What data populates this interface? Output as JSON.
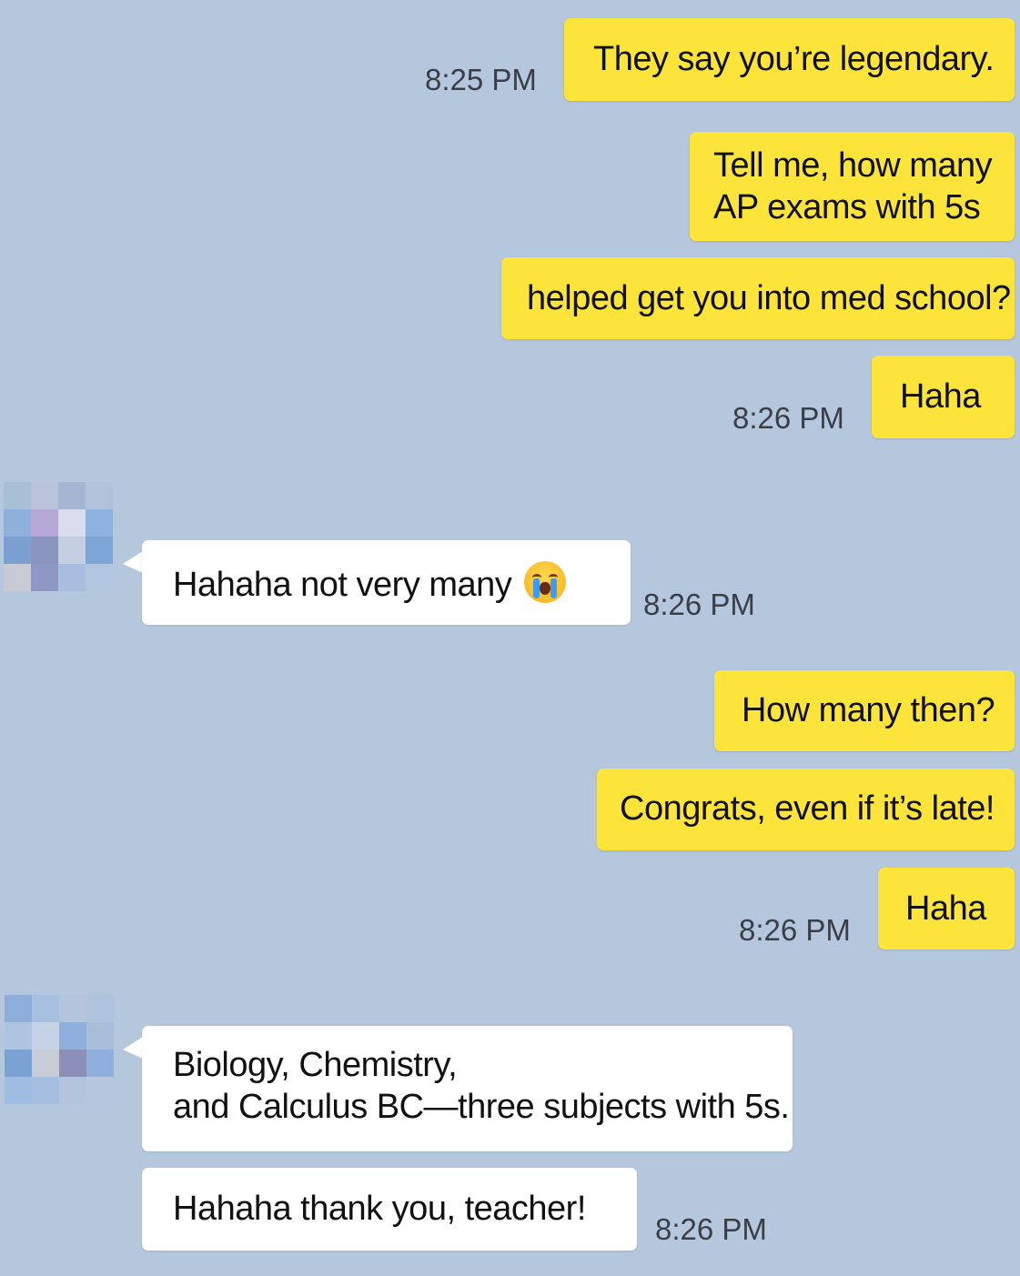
{
  "messages": {
    "m1": {
      "text": "They say you’re legendary.",
      "time": "8:25 PM"
    },
    "m2": {
      "line1": "Tell me, how many",
      "line2": "AP exams with 5s"
    },
    "m3": {
      "text": "helped get you into med school?"
    },
    "m4": {
      "text": "Haha",
      "time": "8:26 PM"
    },
    "m5": {
      "text": "Hahaha not very many",
      "emoji": "loudly-crying-face",
      "time": "8:26 PM"
    },
    "m6": {
      "text": "How many then?"
    },
    "m7": {
      "text": "Congrats, even if it’s late!"
    },
    "m8": {
      "text": "Haha",
      "time": "8:26 PM"
    },
    "m9": {
      "line1": "Biology, Chemistry,",
      "line2": "and Calculus BC—three subjects with 5s."
    },
    "m10": {
      "text": "Hahaha thank you, teacher!",
      "time": "8:26 PM"
    }
  },
  "colors": {
    "background": "#b5c7dd",
    "sent_bubble": "#fde43a",
    "received_bubble": "#ffffff"
  },
  "icons": {
    "avatar": "pixelated-avatar-icon"
  }
}
